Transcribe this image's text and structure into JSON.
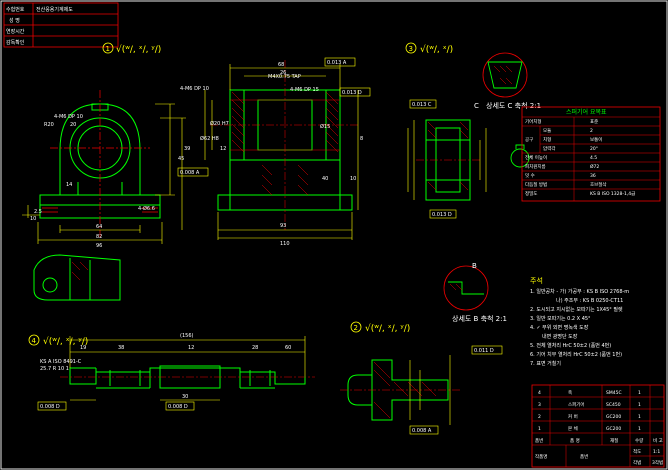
{
  "title_block": {
    "rows": [
      {
        "label": "수험번호",
        "value": "전산응용기계제도"
      },
      {
        "label": "성 명",
        "value": ""
      },
      {
        "label": "연장시간",
        "value": ""
      },
      {
        "label": "감독확인",
        "value": ""
      }
    ]
  },
  "views": {
    "v1": {
      "num": "1",
      "finish": "√(ʷ∕, ˣ∕, ʸ∕)"
    },
    "v2": {
      "num": "2",
      "finish": "√(ʷ∕, ˣ∕, ʸ∕)"
    },
    "v3": {
      "num": "3",
      "finish": "√(ʷ∕, ˣ∕)"
    },
    "v4": {
      "num": "4",
      "finish": "√(ʷ∕, ˣ∕, ʸ∕)"
    }
  },
  "detail_c": {
    "letter": "C",
    "title": "상세도 C 축척 2:1"
  },
  "detail_b": {
    "letter": "B",
    "title": "상세도 B 축척 2:1"
  },
  "dims_front": [
    "4-M6 DP 10",
    "20",
    "R20",
    "45",
    "2.5",
    "10",
    "14",
    "64",
    "4-Ø6.6",
    "82",
    "96",
    "39",
    "113",
    "A",
    "A"
  ],
  "dims_side": [
    "4-M6 DP 10",
    "4-M6 DP 15",
    "M4X0.75 TAP",
    "68",
    "26",
    "12",
    "10",
    "40",
    "Ø20 H7",
    "Ø15",
    "Ø62 H8",
    "A",
    "93",
    "110",
    "8"
  ],
  "dims_shaft": [
    "(156)",
    "KS A ISO 8491-C",
    "25.7 R 10 1",
    "19",
    "38",
    "12",
    "28",
    "60",
    "30"
  ],
  "spur_table": {
    "title": "스퍼기어 요목표",
    "rows": [
      [
        "기어치형",
        "",
        "표준"
      ],
      [
        "",
        "모듈",
        "2"
      ],
      [
        "공구",
        "치형",
        "보통이"
      ],
      [
        "",
        "압력각",
        "20°"
      ],
      [
        "전체 이높이",
        "",
        "4.5"
      ],
      [
        "피치원지름",
        "",
        "Ø72"
      ],
      [
        "잇 수",
        "",
        "36"
      ],
      [
        "다듬질 방법",
        "",
        "호브절삭"
      ],
      [
        "정밀도",
        "",
        "KS B ISO 1328-1,4급"
      ]
    ]
  },
  "notes": {
    "title": "주석",
    "lines": [
      "1. 일반공차 - 가) 가공부 : KS B ISO 2768-m",
      "나) 주조부 : KS B 0250-CT11",
      "2. 도시되고 지시없는 모따기는 1X45° 필렛",
      "3. 일반 모따기는 0.2 X 45°",
      "4. ✓ 부위 외면 명녹색 도장",
      "내면 광명단 도장",
      "5. 전체 열처리 HrC 50±2 (품번 4번)",
      "6. 기어 치부 열처리 HrC 50±2 (품번 1번)",
      "7. 표면 거칠기"
    ]
  },
  "parts_list": {
    "header": [
      "품번",
      "품 명",
      "재질",
      "수량",
      "비 고"
    ],
    "rows": [
      [
        "4",
        "축",
        "SM45C",
        "1",
        ""
      ],
      [
        "3",
        "스퍼기어",
        "SC450",
        "1",
        ""
      ],
      [
        "2",
        "커 버",
        "GC200",
        "1",
        ""
      ],
      [
        "1",
        "본 체",
        "GC200",
        "1",
        ""
      ]
    ],
    "footer": [
      "작품명",
      "품번",
      "척도",
      "1:1",
      "",
      "각법",
      "3각법"
    ]
  },
  "gdt": [
    "0.013 A",
    "0.013 D",
    "0.013 A",
    "0.008 A",
    "0.013 C",
    "0.013 D",
    "0.008 D",
    "0.008 D",
    "0.011 D",
    "0.008 A"
  ]
}
